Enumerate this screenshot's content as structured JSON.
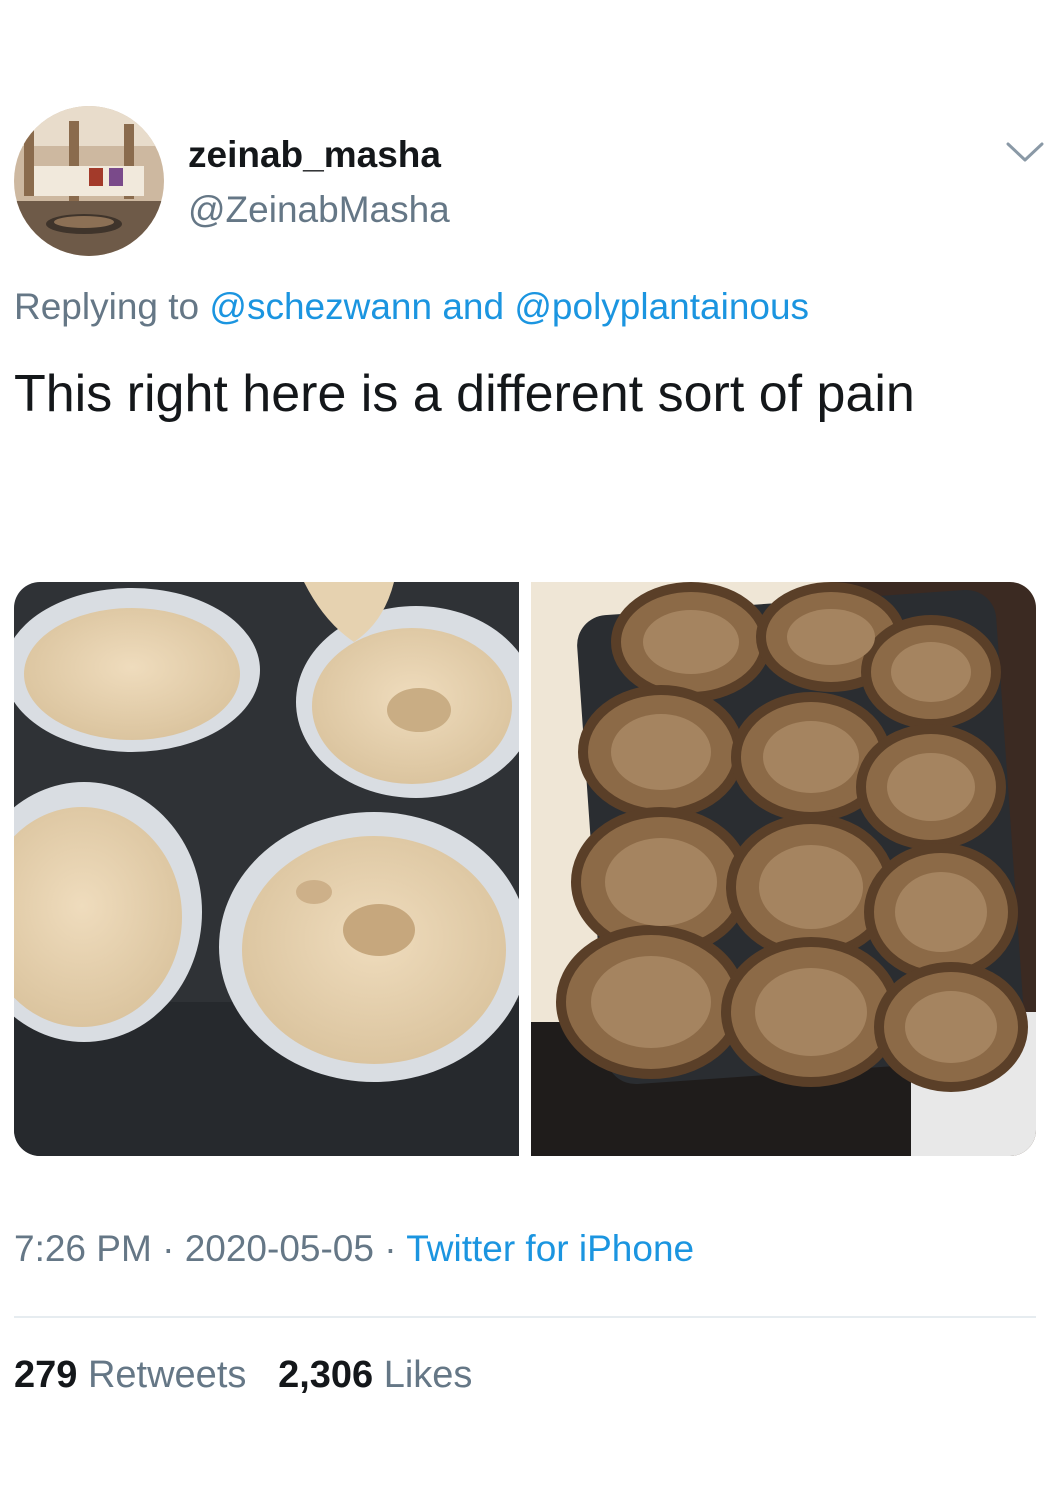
{
  "author": {
    "display_name": "zeinab_masha",
    "handle": "@ZeinabMasha"
  },
  "icons": {
    "menu_caret": "chevron-down-icon"
  },
  "reply": {
    "prefix": "Replying to",
    "mention1": "@schezwann",
    "connector": "and",
    "mention2": "@polyplantainous"
  },
  "tweet": {
    "text": "This right here is a different sort of pain"
  },
  "meta": {
    "time": "7:26 PM",
    "separator": "·",
    "date": "2020-05-05",
    "source": "Twitter for iPhone"
  },
  "stats": {
    "retweets_count": "279",
    "retweets_label": "Retweets",
    "likes_count": "2,306",
    "likes_label": "Likes"
  },
  "colors": {
    "link": "#1b95e0",
    "secondary_text": "#657786",
    "primary_text": "#14171a",
    "divider": "#e6ecf0"
  }
}
